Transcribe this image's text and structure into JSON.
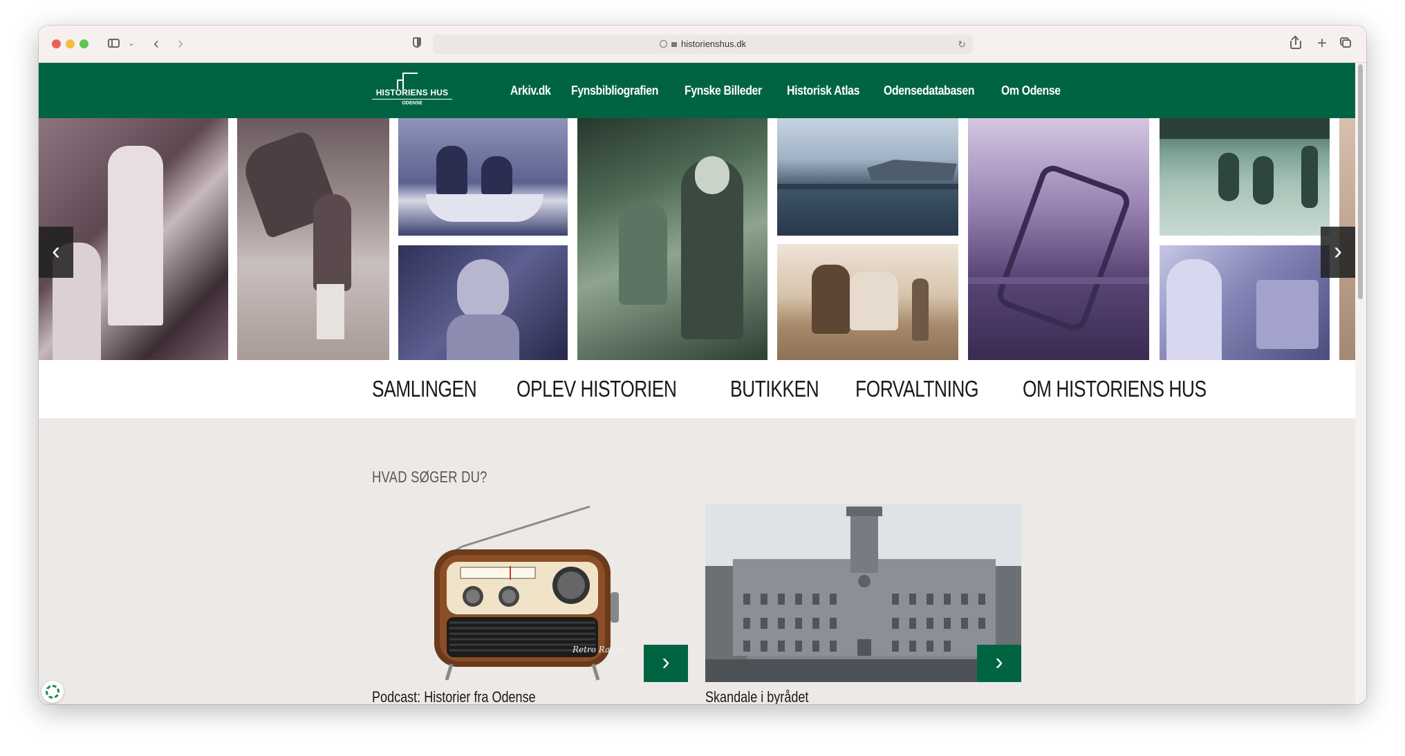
{
  "browser": {
    "url": "historienshus.dk"
  },
  "logo": {
    "name": "HISTORIENS HUS",
    "sub": "ODENSE"
  },
  "top_nav": {
    "items": [
      "Arkiv.dk",
      "Fynsbibliografien",
      "Fynske Billeder",
      "Historisk Atlas",
      "Odensedatabasen",
      "Om Odense"
    ]
  },
  "carousel": {
    "prev_label": "‹",
    "next_label": "›"
  },
  "main_nav": {
    "items": [
      "SAMLINGEN",
      "OPLEV HISTORIEN",
      "BUTIKKEN",
      "FORVALTNING",
      "OM HISTORIENS HUS"
    ]
  },
  "section": {
    "heading": "HVAD SØGER DU?"
  },
  "cards": [
    {
      "title": "Podcast: Historier fra Odense",
      "radio_brand": "Retro Radio",
      "arrow": "›"
    },
    {
      "title": "Skandale i byrådet",
      "arrow": "›"
    }
  ],
  "colors": {
    "brand_green": "#006443",
    "page_bg": "#ede9e6"
  }
}
